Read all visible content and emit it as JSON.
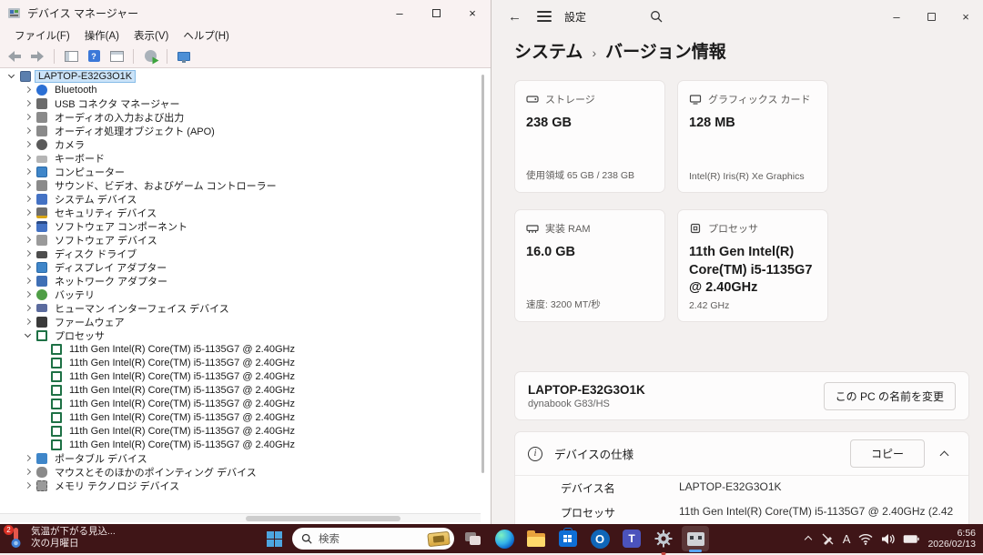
{
  "device_manager": {
    "title": "デバイス マネージャー",
    "window_controls": {
      "minimize": "–",
      "close": "×"
    },
    "menu": {
      "file": "ファイル(F)",
      "action": "操作(A)",
      "view": "表示(V)",
      "help": "ヘルプ(H)"
    },
    "tree": [
      {
        "label": "LAPTOP-E32G3O1K",
        "icon": "computer-icon"
      },
      {
        "label": "Bluetooth",
        "icon": "bluetooth-icon"
      },
      {
        "label": "USB コネクタ マネージャー",
        "icon": "usb-icon"
      },
      {
        "label": "オーディオの入力および出力",
        "icon": "audio-icon"
      },
      {
        "label": "オーディオ処理オブジェクト (APO)",
        "icon": "audio-icon"
      },
      {
        "label": "カメラ",
        "icon": "camera-icon"
      },
      {
        "label": "キーボード",
        "icon": "keyboard-icon"
      },
      {
        "label": "コンピューター",
        "icon": "monitor-icon"
      },
      {
        "label": "サウンド、ビデオ、およびゲーム コントローラー",
        "icon": "sound-icon"
      },
      {
        "label": "システム デバイス",
        "icon": "system-icon"
      },
      {
        "label": "セキュリティ デバイス",
        "icon": "security-icon"
      },
      {
        "label": "ソフトウェア コンポーネント",
        "icon": "software-component-icon"
      },
      {
        "label": "ソフトウェア デバイス",
        "icon": "software-device-icon"
      },
      {
        "label": "ディスク ドライブ",
        "icon": "disk-icon"
      },
      {
        "label": "ディスプレイ アダプター",
        "icon": "display-icon"
      },
      {
        "label": "ネットワーク アダプター",
        "icon": "network-icon"
      },
      {
        "label": "バッテリ",
        "icon": "battery-icon"
      },
      {
        "label": "ヒューマン インターフェイス デバイス",
        "icon": "hid-icon"
      },
      {
        "label": "ファームウェア",
        "icon": "firmware-icon"
      },
      {
        "label": "プロセッサ",
        "icon": "processor-icon"
      },
      {
        "label": "11th Gen Intel(R) Core(TM) i5-1135G7 @ 2.40GHz",
        "icon": "processor-icon"
      },
      {
        "label": "11th Gen Intel(R) Core(TM) i5-1135G7 @ 2.40GHz",
        "icon": "processor-icon"
      },
      {
        "label": "11th Gen Intel(R) Core(TM) i5-1135G7 @ 2.40GHz",
        "icon": "processor-icon"
      },
      {
        "label": "11th Gen Intel(R) Core(TM) i5-1135G7 @ 2.40GHz",
        "icon": "processor-icon"
      },
      {
        "label": "11th Gen Intel(R) Core(TM) i5-1135G7 @ 2.40GHz",
        "icon": "processor-icon"
      },
      {
        "label": "11th Gen Intel(R) Core(TM) i5-1135G7 @ 2.40GHz",
        "icon": "processor-icon"
      },
      {
        "label": "11th Gen Intel(R) Core(TM) i5-1135G7 @ 2.40GHz",
        "icon": "processor-icon"
      },
      {
        "label": "11th Gen Intel(R) Core(TM) i5-1135G7 @ 2.40GHz",
        "icon": "processor-icon"
      },
      {
        "label": "ポータブル デバイス",
        "icon": "portable-icon"
      },
      {
        "label": "マウスとそのほかのポインティング デバイス",
        "icon": "mouse-icon"
      },
      {
        "label": "メモリ テクノロジ デバイス",
        "icon": "memory-icon"
      }
    ]
  },
  "settings": {
    "app_title": "設定",
    "breadcrumb": {
      "section": "システム",
      "separator": "›",
      "page": "バージョン情報"
    },
    "window_controls": {
      "minimize": "–",
      "close": "×"
    },
    "cards": [
      {
        "label": "ストレージ",
        "value": "238 GB",
        "caption": "使用領域 65 GB / 238 GB",
        "icon": "storage-icon"
      },
      {
        "label": "グラフィックス カード",
        "value": "128 MB",
        "caption": "Intel(R) Iris(R) Xe Graphics",
        "icon": "gpu-icon"
      },
      {
        "label": "実装 RAM",
        "value": "16.0 GB",
        "caption": "速度: 3200 MT/秒",
        "icon": "ram-icon"
      },
      {
        "label": "プロセッサ",
        "value": "11th Gen Intel(R) Core(TM) i5-1135G7 @ 2.40GHz",
        "caption": "2.42 GHz",
        "icon": "cpu-icon"
      }
    ],
    "device_name_card": {
      "name": "LAPTOP-E32G3O1K",
      "model": "dynabook G83/HS",
      "rename_button": "この PC の名前を変更"
    },
    "specs_card": {
      "title": "デバイスの仕様",
      "copy_button": "コピー",
      "rows": [
        {
          "label": "デバイス名",
          "value": "LAPTOP-E32G3O1K"
        },
        {
          "label": "プロセッサ",
          "value": "11th Gen Intel(R) Core(TM) i5-1135G7 @ 2.40GHz (2.42"
        }
      ]
    }
  },
  "taskbar": {
    "weather_widget": {
      "badge": "2",
      "line1": "気温が下がる見込...",
      "line2": "次の月曜日"
    },
    "search_placeholder": "検索",
    "outlook_initial": "O",
    "teams_initial": "T",
    "ime_mode": "A",
    "clock": {
      "time": "6:56",
      "date": "2026/02/13"
    }
  },
  "colors": {
    "taskbar": "#3f1517",
    "accent": "#58a6ff",
    "selection": "#cbe3f8"
  }
}
